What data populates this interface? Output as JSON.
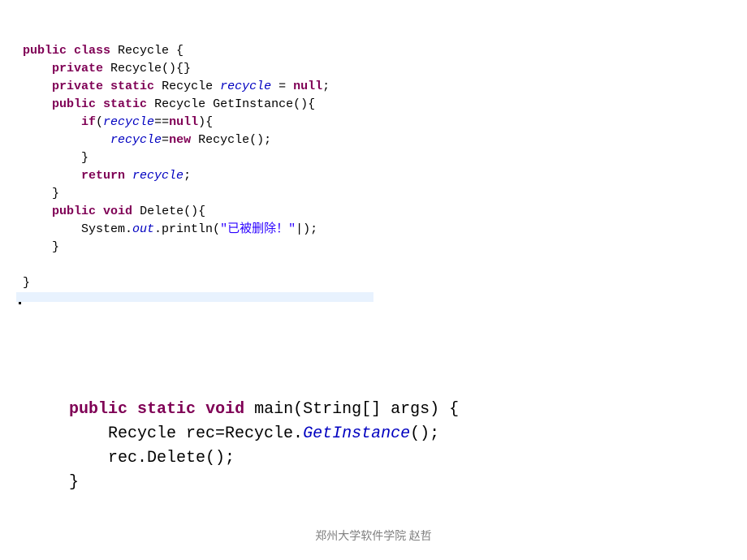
{
  "block1": {
    "l1": {
      "kw1": "public",
      "kw2": "class",
      "name": " Recycle {"
    },
    "l2": {
      "kw1": "private",
      "rest": " Recycle(){}"
    },
    "l3": {
      "kw1": "private",
      "kw2": "static",
      "mid": " Recycle ",
      "var": "recycle",
      "rest": " = ",
      "kw3": "null",
      "end": ";"
    },
    "l4": {
      "kw1": "public",
      "kw2": "static",
      "rest": " Recycle GetInstance(){"
    },
    "l5": {
      "kw1": "if",
      "open": "(",
      "var": "recycle",
      "op": "==",
      "kw2": "null",
      "close": "){"
    },
    "l6": {
      "var": "recycle",
      "op": "=",
      "kw1": "new",
      "rest": " Recycle();"
    },
    "l7": {
      "brace": "}"
    },
    "l8": {
      "kw1": "return",
      "sp": " ",
      "var": "recycle",
      "end": ";"
    },
    "l9": {
      "brace": "}"
    },
    "l10": {
      "kw1": "public",
      "kw2": "void",
      "rest": " Delete(){"
    },
    "l11": {
      "pre": "System.",
      "out": "out",
      "mid": ".println(",
      "str": "\"已被删除！\"",
      "cursor": "|",
      "end": ");"
    },
    "l12": {
      "brace": "}"
    },
    "l13": {
      "brace": "}"
    }
  },
  "block2": {
    "l1": {
      "kw1": "public",
      "kw2": "static",
      "kw3": "void",
      "rest": " main(String[] args) {"
    },
    "l2": {
      "pre": "Recycle rec=Recycle.",
      "call": "GetInstance",
      "end": "();"
    },
    "l3": {
      "text": "rec.Delete();"
    },
    "l4": {
      "brace": "}"
    }
  },
  "footer": "郑州大学软件学院 赵哲"
}
